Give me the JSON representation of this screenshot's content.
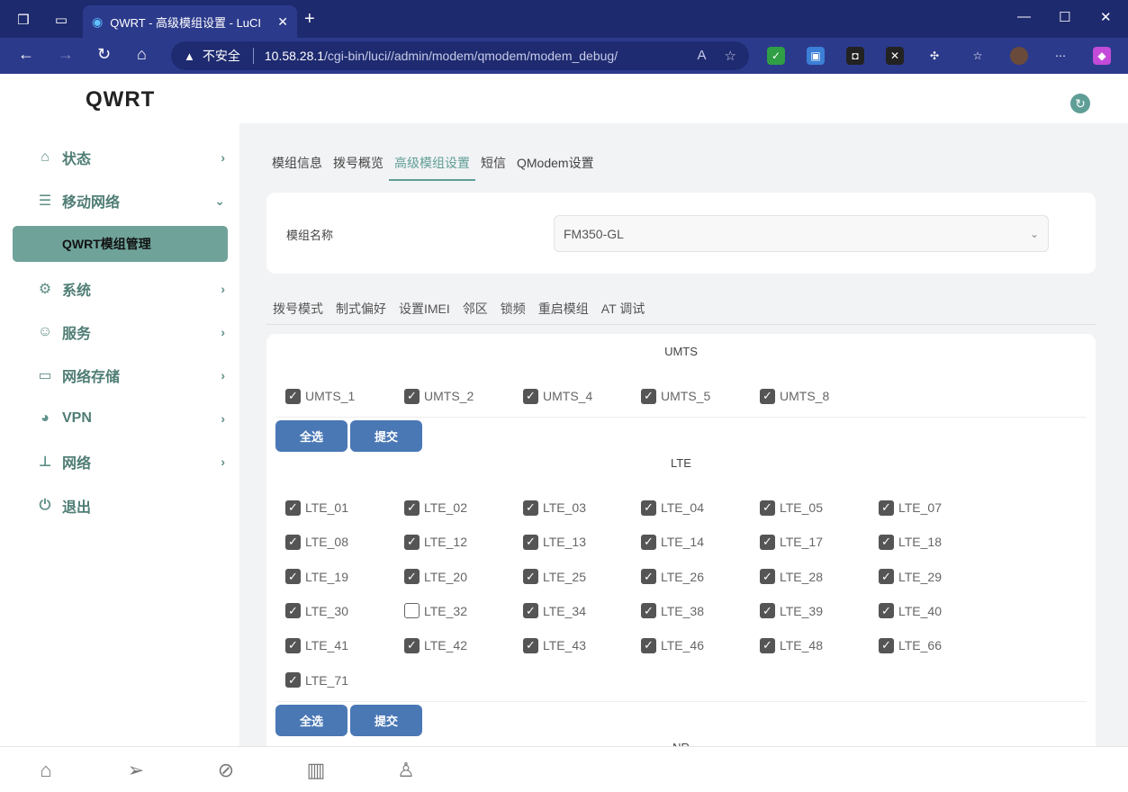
{
  "browser": {
    "tab_title": "QWRT - 高级模组设置 - LuCI",
    "insecure_label": "不安全",
    "url_host": "10.58.28.1",
    "url_path": "/cgi-bin/luci//admin/modem/qmodem/modem_debug/"
  },
  "app": {
    "logo": "QWRT"
  },
  "sidebar": {
    "items": [
      {
        "label": "状态",
        "icon": "home-icon"
      },
      {
        "label": "移动网络",
        "icon": "database-icon"
      },
      {
        "label": "系统",
        "icon": "gear-icon"
      },
      {
        "label": "服务",
        "icon": "user-icon"
      },
      {
        "label": "网络存储",
        "icon": "drive-icon"
      },
      {
        "label": "VPN",
        "icon": "globe-icon"
      },
      {
        "label": "网络",
        "icon": "network-icon"
      },
      {
        "label": "退出",
        "icon": "power-icon"
      }
    ],
    "active_sub": "QWRT模组管理"
  },
  "main": {
    "tabs": [
      "模组信息",
      "拨号概览",
      "高级模组设置",
      "短信",
      "QModem设置"
    ],
    "active_tab": "高级模组设置",
    "module_label": "模组名称",
    "module_value": "FM350-GL",
    "subtabs": [
      "拨号模式",
      "制式偏好",
      "设置IMEI",
      "邻区",
      "锁频",
      "重启模组",
      "AT 调试"
    ],
    "select_all": "全选",
    "submit": "提交",
    "umts": {
      "title": "UMTS",
      "bands": [
        {
          "label": "UMTS_1",
          "checked": true
        },
        {
          "label": "UMTS_2",
          "checked": true
        },
        {
          "label": "UMTS_4",
          "checked": true
        },
        {
          "label": "UMTS_5",
          "checked": true
        },
        {
          "label": "UMTS_8",
          "checked": true
        }
      ]
    },
    "lte": {
      "title": "LTE",
      "bands": [
        {
          "label": "LTE_01",
          "checked": true
        },
        {
          "label": "LTE_02",
          "checked": true
        },
        {
          "label": "LTE_03",
          "checked": true
        },
        {
          "label": "LTE_04",
          "checked": true
        },
        {
          "label": "LTE_05",
          "checked": true
        },
        {
          "label": "LTE_07",
          "checked": true
        },
        {
          "label": "LTE_08",
          "checked": true
        },
        {
          "label": "LTE_12",
          "checked": true
        },
        {
          "label": "LTE_13",
          "checked": true
        },
        {
          "label": "LTE_14",
          "checked": true
        },
        {
          "label": "LTE_17",
          "checked": true
        },
        {
          "label": "LTE_18",
          "checked": true
        },
        {
          "label": "LTE_19",
          "checked": true
        },
        {
          "label": "LTE_20",
          "checked": true
        },
        {
          "label": "LTE_25",
          "checked": true
        },
        {
          "label": "LTE_26",
          "checked": true
        },
        {
          "label": "LTE_28",
          "checked": true
        },
        {
          "label": "LTE_29",
          "checked": true
        },
        {
          "label": "LTE_30",
          "checked": true
        },
        {
          "label": "LTE_32",
          "checked": false
        },
        {
          "label": "LTE_34",
          "checked": true
        },
        {
          "label": "LTE_38",
          "checked": true
        },
        {
          "label": "LTE_39",
          "checked": true
        },
        {
          "label": "LTE_40",
          "checked": true
        },
        {
          "label": "LTE_41",
          "checked": true
        },
        {
          "label": "LTE_42",
          "checked": true
        },
        {
          "label": "LTE_43",
          "checked": true
        },
        {
          "label": "LTE_46",
          "checked": true
        },
        {
          "label": "LTE_48",
          "checked": true
        },
        {
          "label": "LTE_66",
          "checked": true
        },
        {
          "label": "LTE_71",
          "checked": true
        }
      ]
    },
    "nr_title_partial": "NR"
  },
  "bottom_nav": [
    "home-icon",
    "send-icon",
    "link-icon",
    "chart-icon",
    "user-icon"
  ]
}
